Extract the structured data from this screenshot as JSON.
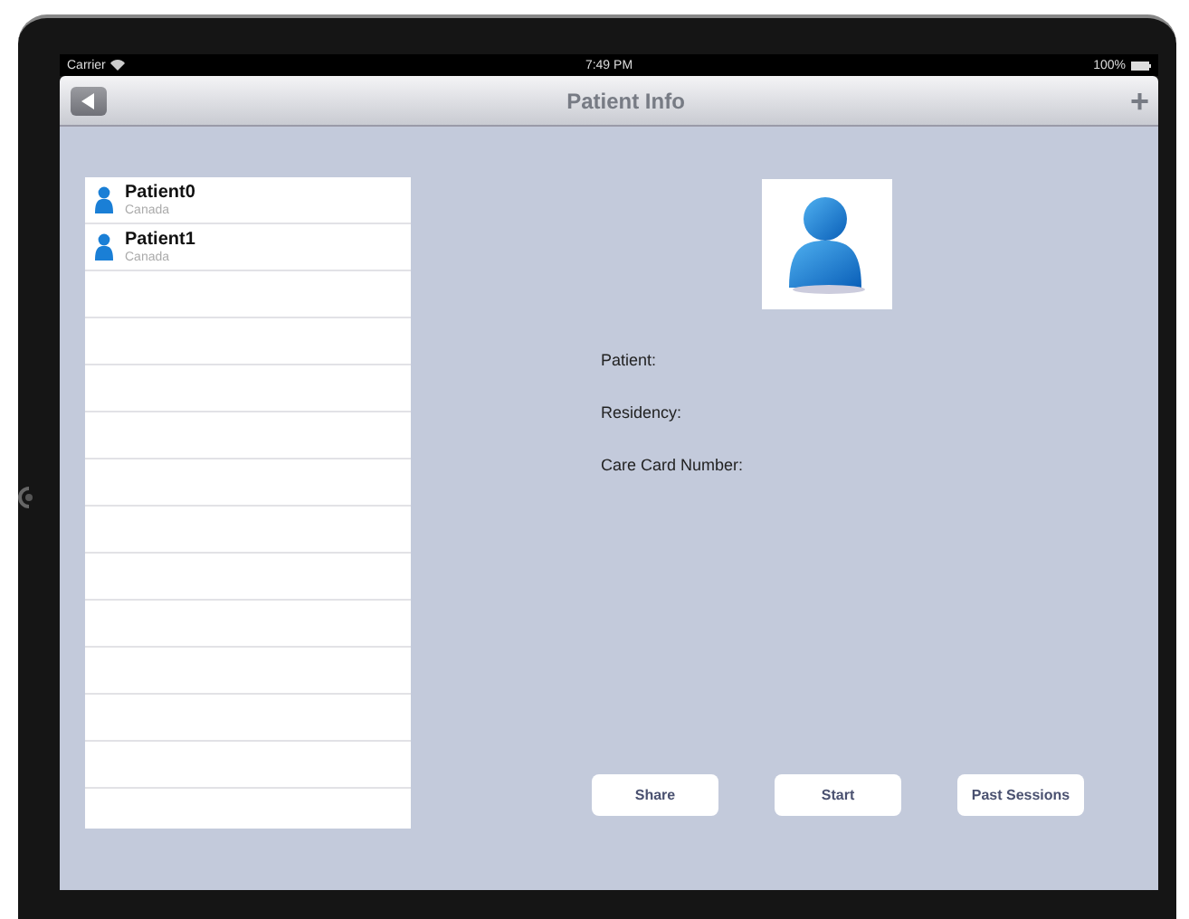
{
  "status_bar": {
    "carrier": "Carrier",
    "time": "7:49 PM",
    "battery": "100%"
  },
  "nav_bar": {
    "title": "Patient Info",
    "add_button": "+"
  },
  "patients": [
    {
      "name": "Patient0",
      "country": "Canada"
    },
    {
      "name": "Patient1",
      "country": "Canada"
    }
  ],
  "fields": [
    {
      "label": "Patient:"
    },
    {
      "label": "Residency:"
    },
    {
      "label": "Care Card Number:"
    }
  ],
  "buttons": [
    "Share",
    "Start",
    "Past Sessions"
  ]
}
